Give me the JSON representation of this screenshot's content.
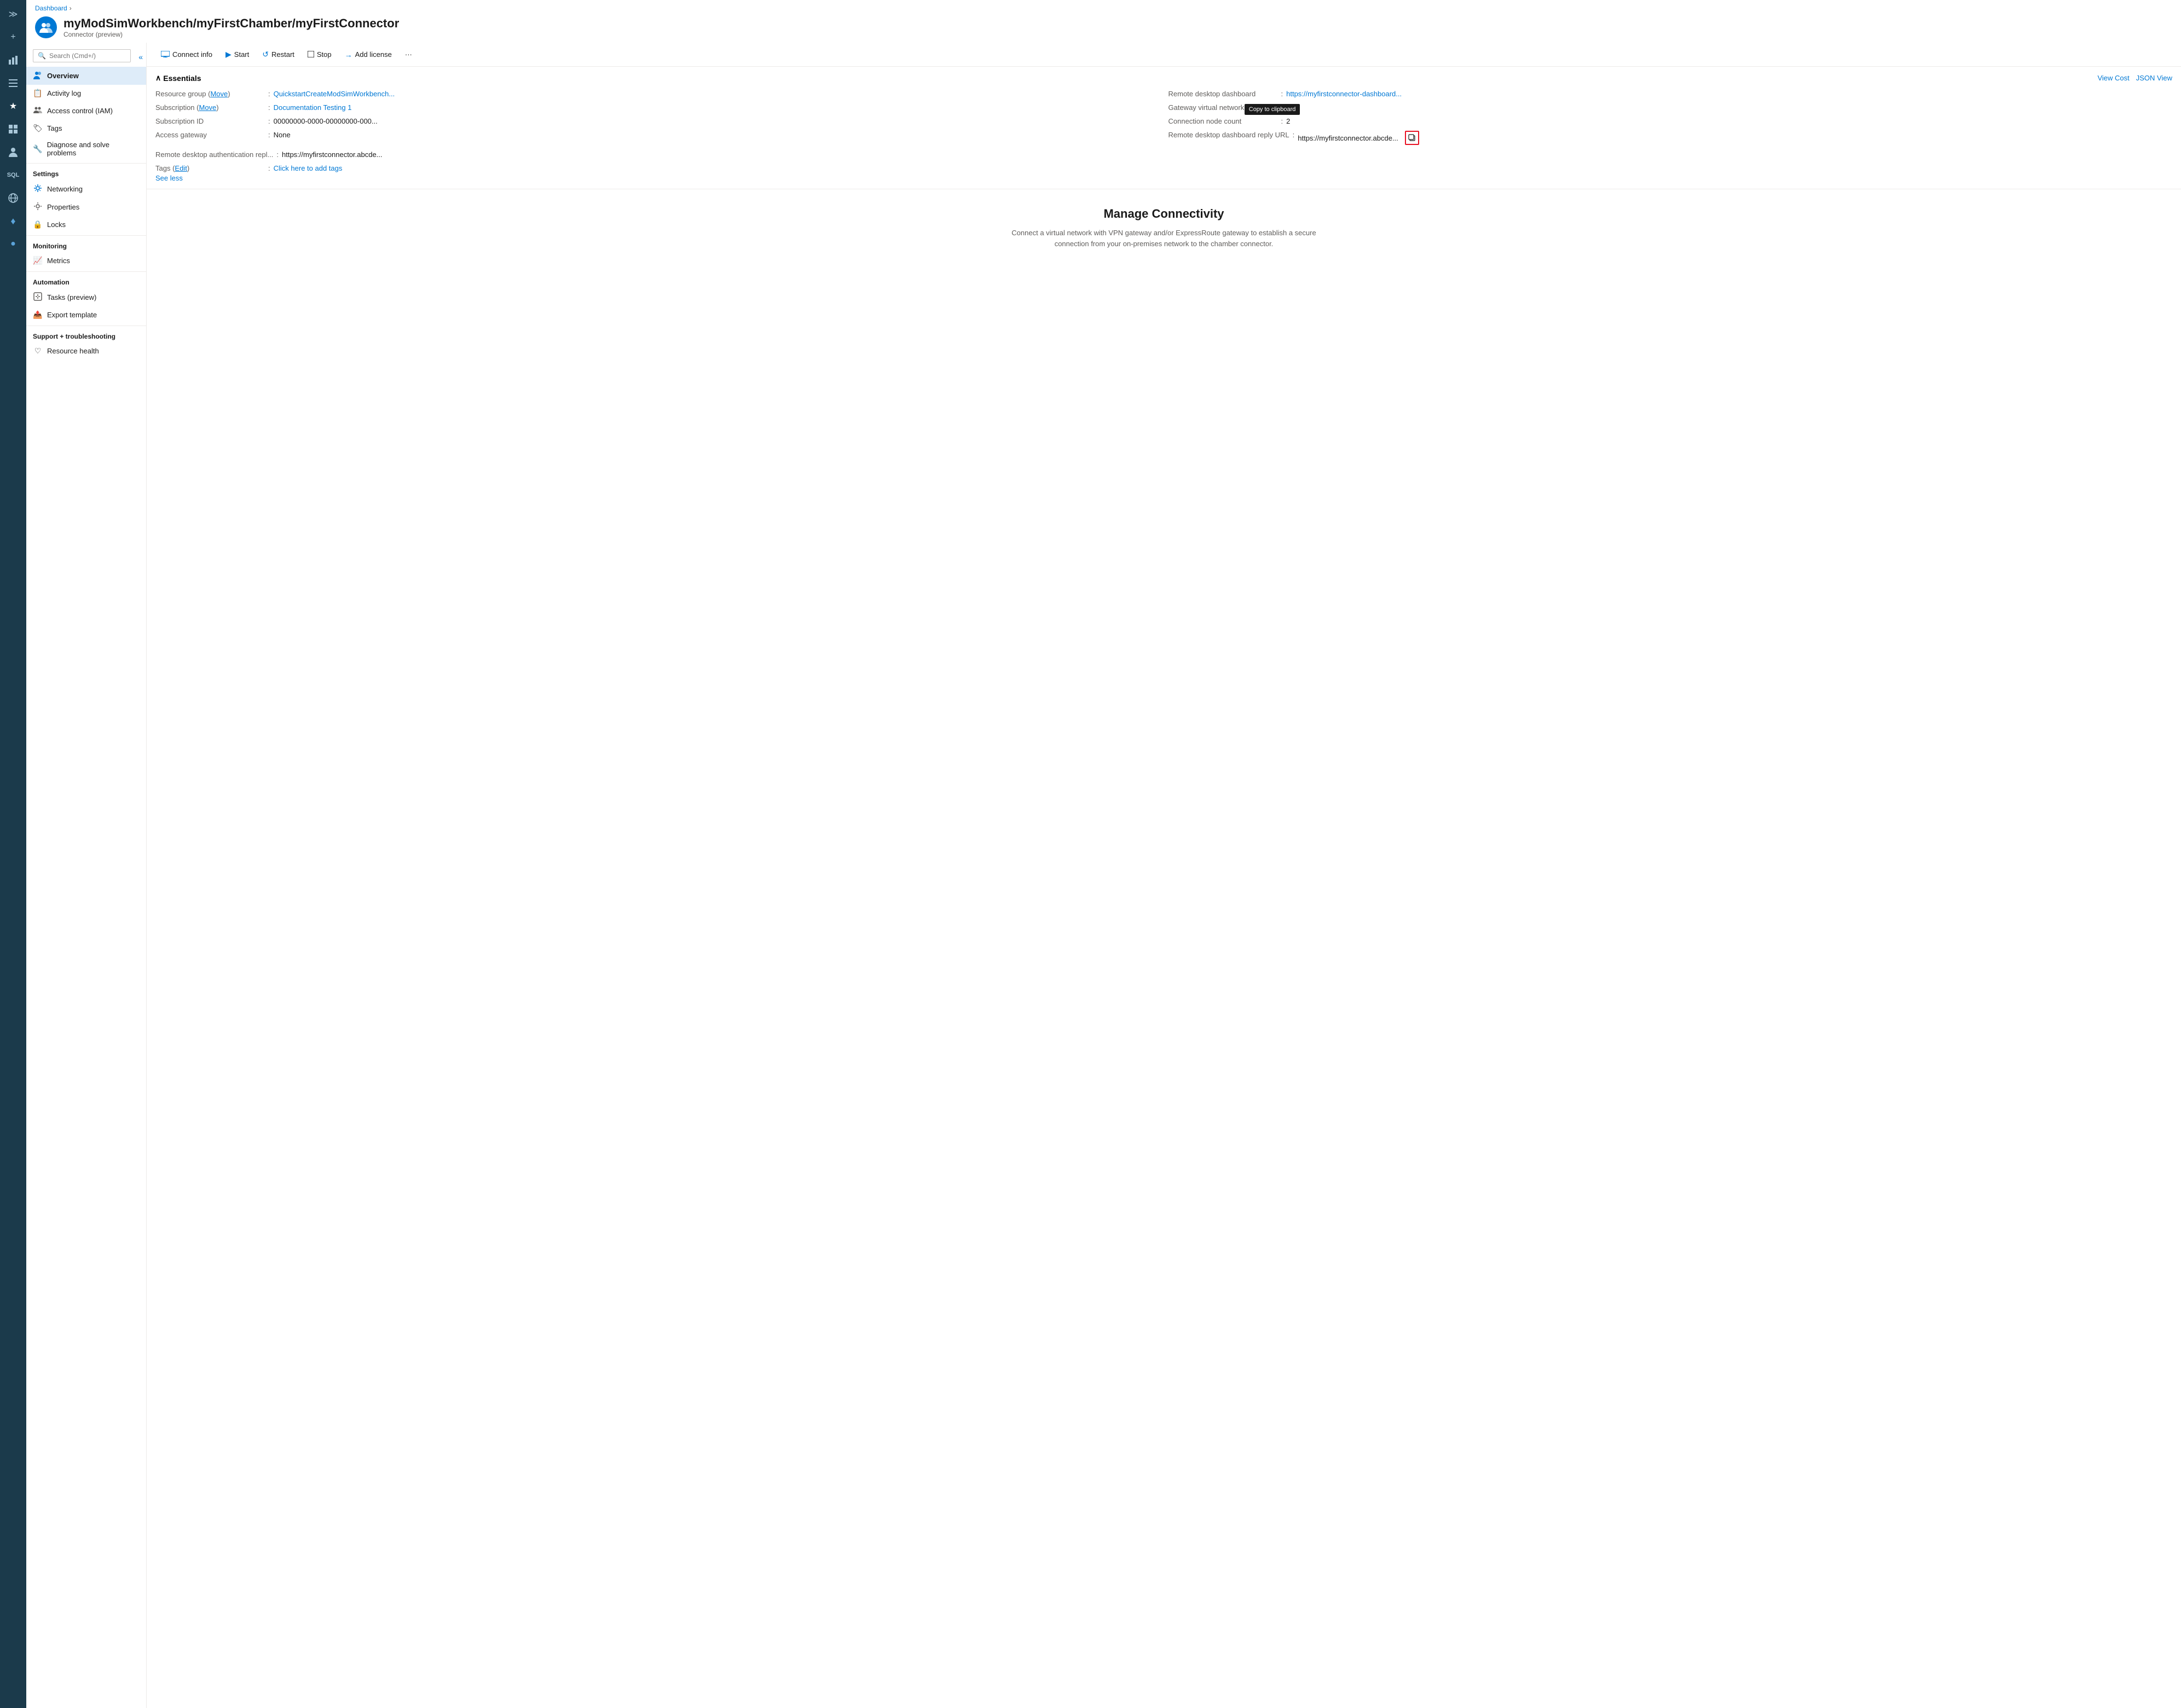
{
  "iconbar": {
    "items": [
      {
        "name": "chevron-expand",
        "icon": "≫",
        "active": false
      },
      {
        "name": "plus",
        "icon": "+",
        "active": false
      },
      {
        "name": "chart",
        "icon": "📊",
        "active": false
      },
      {
        "name": "menu",
        "icon": "☰",
        "active": false
      },
      {
        "name": "star",
        "icon": "★",
        "active": true
      },
      {
        "name": "grid",
        "icon": "⊞",
        "active": false
      },
      {
        "name": "person",
        "icon": "👤",
        "active": false
      },
      {
        "name": "sql",
        "icon": "⚙",
        "active": false
      },
      {
        "name": "globe",
        "icon": "🌐",
        "active": false
      },
      {
        "name": "cloud",
        "icon": "☁",
        "active": false
      },
      {
        "name": "coin",
        "icon": "💰",
        "active": false
      }
    ]
  },
  "breadcrumb": {
    "items": [
      "Dashboard"
    ],
    "separator": "›"
  },
  "header": {
    "title": "myModSimWorkbench/myFirstChamber/myFirstConnector",
    "subtitle": "Connector (preview)"
  },
  "search": {
    "placeholder": "Search (Cmd+/)"
  },
  "sidebar": {
    "items": [
      {
        "id": "overview",
        "label": "Overview",
        "icon": "👥",
        "active": true,
        "section": ""
      },
      {
        "id": "activity-log",
        "label": "Activity log",
        "icon": "📋",
        "active": false,
        "section": ""
      },
      {
        "id": "access-control",
        "label": "Access control (IAM)",
        "icon": "👥",
        "active": false,
        "section": ""
      },
      {
        "id": "tags",
        "label": "Tags",
        "icon": "🏷",
        "active": false,
        "section": ""
      },
      {
        "id": "diagnose",
        "label": "Diagnose and solve problems",
        "icon": "🔧",
        "active": false,
        "section": ""
      },
      {
        "id": "settings-section",
        "label": "Settings",
        "section": true
      },
      {
        "id": "networking",
        "label": "Networking",
        "icon": "⚙",
        "active": false,
        "section": ""
      },
      {
        "id": "properties",
        "label": "Properties",
        "icon": "⚙",
        "active": false,
        "section": ""
      },
      {
        "id": "locks",
        "label": "Locks",
        "icon": "🔒",
        "active": false,
        "section": ""
      },
      {
        "id": "monitoring-section",
        "label": "Monitoring",
        "section": true
      },
      {
        "id": "metrics",
        "label": "Metrics",
        "icon": "📈",
        "active": false,
        "section": ""
      },
      {
        "id": "automation-section",
        "label": "Automation",
        "section": true
      },
      {
        "id": "tasks",
        "label": "Tasks (preview)",
        "icon": "⚙",
        "active": false,
        "section": ""
      },
      {
        "id": "export",
        "label": "Export template",
        "icon": "📤",
        "active": false,
        "section": ""
      },
      {
        "id": "support-section",
        "label": "Support + troubleshooting",
        "section": true
      },
      {
        "id": "resource-health",
        "label": "Resource health",
        "icon": "♡",
        "active": false,
        "section": ""
      }
    ]
  },
  "toolbar": {
    "buttons": [
      {
        "id": "connect-info",
        "label": "Connect info",
        "icon": "▶",
        "icon_type": "monitor"
      },
      {
        "id": "start",
        "label": "Start",
        "icon": "▶"
      },
      {
        "id": "restart",
        "label": "Restart",
        "icon": "↺"
      },
      {
        "id": "stop",
        "label": "Stop",
        "icon": "□"
      },
      {
        "id": "add-license",
        "label": "Add license",
        "icon": "→"
      },
      {
        "id": "more",
        "label": "...",
        "icon": ""
      }
    ]
  },
  "essentials": {
    "title": "Essentials",
    "collapse_icon": "∧",
    "view_cost": "View Cost",
    "json_view": "JSON View",
    "rows": [
      {
        "label": "Resource group (Move)",
        "value": "QuickstartCreateModSimWorkbench...",
        "isLink": true,
        "hasMove": false,
        "linkValue": "QuickstartCreateModSimWorkbench..."
      },
      {
        "label": "Subscription (Move)",
        "value": "Documentation Testing 1",
        "isLink": true,
        "hasMove": false
      },
      {
        "label": "Subscription ID",
        "value": "00000000-0000-00000000-000...",
        "isLink": false
      },
      {
        "label": "Access gateway",
        "value": "None",
        "isLink": false
      },
      {
        "label": "Remote desktop dashboard",
        "value": "https://myfirstconnector-dashboard...",
        "isLink": true
      },
      {
        "label": "Gateway virtual network",
        "value": "---",
        "isLink": false
      },
      {
        "label": "Connection node count",
        "value": "2",
        "isLink": false,
        "hasCopyTooltip": false
      },
      {
        "label": "Remote desktop dashboard reply URL",
        "value": "https://myfirstconnector.abcde...",
        "isLink": false,
        "hasCopyBtn": true,
        "hasCopyTooltip": true
      },
      {
        "label": "Remote desktop authentication repl...",
        "value": "https://myfirstconnector.abcde...",
        "isLink": false
      },
      {
        "label": "Tags (Edit)",
        "value": "Click here to add tags",
        "isLink": true,
        "isTags": true
      }
    ],
    "see_less": "See less"
  },
  "manage_connectivity": {
    "title": "Manage Connectivity",
    "description": "Connect a virtual network with VPN gateway and/or ExpressRoute gateway to establish a secure connection from your on-premises network to the chamber connector."
  },
  "copy_tooltip": {
    "label": "Copy to clipboard"
  }
}
